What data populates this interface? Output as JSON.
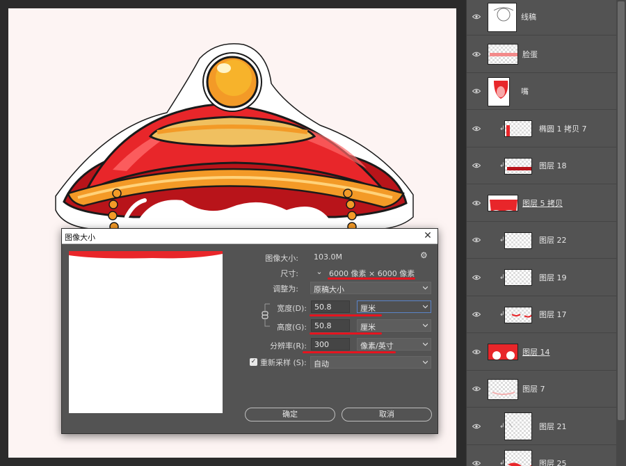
{
  "dialog": {
    "title": "图像大小",
    "close": "✕",
    "image_size_label": "图像大小:",
    "image_size_value": "103.0M",
    "dimensions_label": "尺寸:",
    "dimensions_value": "6000 像素  ×  6000 像素",
    "fit_to_label": "调整为:",
    "fit_to_value": "原稿大小",
    "width_label": "宽度(D):",
    "width_value": "50.8",
    "width_unit": "厘米",
    "height_label": "高度(G):",
    "height_value": "50.8",
    "height_unit": "厘米",
    "resolution_label": "分辨率(R):",
    "resolution_value": "300",
    "resolution_unit": "像素/英寸",
    "resample_label": "重新采样 (S):",
    "resample_checked": true,
    "resample_value": "自动",
    "ok": "确定",
    "cancel": "取消"
  },
  "layers": [
    {
      "name": "线稿",
      "clipped": false,
      "underline": false
    },
    {
      "name": "脸蛋",
      "clipped": false,
      "underline": false
    },
    {
      "name": "嘴",
      "clipped": false,
      "underline": false
    },
    {
      "name": "椭圆 1 拷贝 7",
      "clipped": true,
      "underline": false
    },
    {
      "name": "图层 18",
      "clipped": true,
      "underline": false
    },
    {
      "name": "图层 5 拷贝",
      "clipped": false,
      "underline": true
    },
    {
      "name": "图层 22",
      "clipped": true,
      "underline": false
    },
    {
      "name": "图层 19",
      "clipped": true,
      "underline": false
    },
    {
      "name": "图层 17",
      "clipped": true,
      "underline": false
    },
    {
      "name": "图层 14",
      "clipped": false,
      "underline": true
    },
    {
      "name": "图层 7",
      "clipped": false,
      "underline": false
    },
    {
      "name": "图层 21",
      "clipped": true,
      "underline": false
    },
    {
      "name": "图层 25",
      "clipped": true,
      "underline": false
    }
  ],
  "colors": {
    "annotation_red": "#e6141f",
    "hat_red": "#e8262a",
    "hat_orange": "#f39a27",
    "knob_gold": "#f5a623",
    "panel_gray": "#535353"
  }
}
